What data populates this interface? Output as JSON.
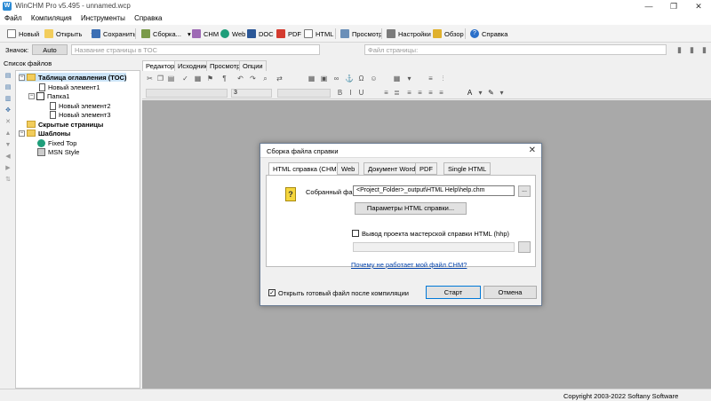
{
  "window": {
    "title": "WinCHM Pro v5.495 - unnamed.wcp",
    "icon": "winchm-app-icon"
  },
  "menu": [
    "Файл",
    "Компиляция",
    "Инструменты",
    "Справка"
  ],
  "toolbar": {
    "new": "Новый",
    "open": "Открыть",
    "save": "Сохранить",
    "build": "Сборка...",
    "chm": "CHM",
    "web": "Web",
    "doc": "DOC",
    "pdf": "PDF",
    "html": "HTML",
    "preview": "Просмотр",
    "settings": "Настройки",
    "browse": "Обзор",
    "help": "Справка"
  },
  "bar2": {
    "icon_label": "Значок:",
    "auto": "Auto",
    "page_name_placeholder": "Название страницы в TOC",
    "page_file_placeholder": "Файл страницы:"
  },
  "left_panel": {
    "header": "Список файлов"
  },
  "tree": [
    {
      "label": "Таблица оглавления (TOC)",
      "type": "folder",
      "bold": true,
      "level": 0
    },
    {
      "label": "Новый элемент1",
      "type": "doc",
      "level": 1
    },
    {
      "label": "Папка1",
      "type": "book",
      "level": 1
    },
    {
      "label": "Новый элемент2",
      "type": "doc",
      "level": 2
    },
    {
      "label": "Новый элемент3",
      "type": "doc",
      "level": 2
    },
    {
      "label": "Скрытые страницы",
      "type": "folder",
      "bold": true,
      "level": 0
    },
    {
      "label": "Шаблоны",
      "type": "folder",
      "bold": true,
      "level": 0
    },
    {
      "label": "Fixed Top",
      "type": "globe",
      "level": 1
    },
    {
      "label": "MSN Style",
      "type": "window",
      "level": 1
    }
  ],
  "editor_tabs": [
    "Редактор",
    "Исходник",
    "Просмотр",
    "Опции темы"
  ],
  "editor_toolbar": {
    "font_size": "3"
  },
  "dialog": {
    "title": "Сборка файла справки",
    "tabs": [
      "HTML справка (CHM)",
      "Web",
      "Документ Word",
      "PDF",
      "Single HTML"
    ],
    "compiled_file_label": "Собранный файл:",
    "compiled_file_value": "<Project_Folder>_output\\HTML Help\\help.chm",
    "params_button": "Параметры HTML справки...",
    "hhp_checkbox_label": "Вывод проекта мастерской справки HTML (hhp)",
    "why_link": "Почему не работает мой файл CHM?",
    "open_after_label": "Открыть готовый файл после компиляции",
    "start_button": "Старт",
    "cancel_button": "Отмена",
    "dots": "..."
  },
  "status": {
    "copyright": "Copyright 2003-2022 Softany Software"
  }
}
